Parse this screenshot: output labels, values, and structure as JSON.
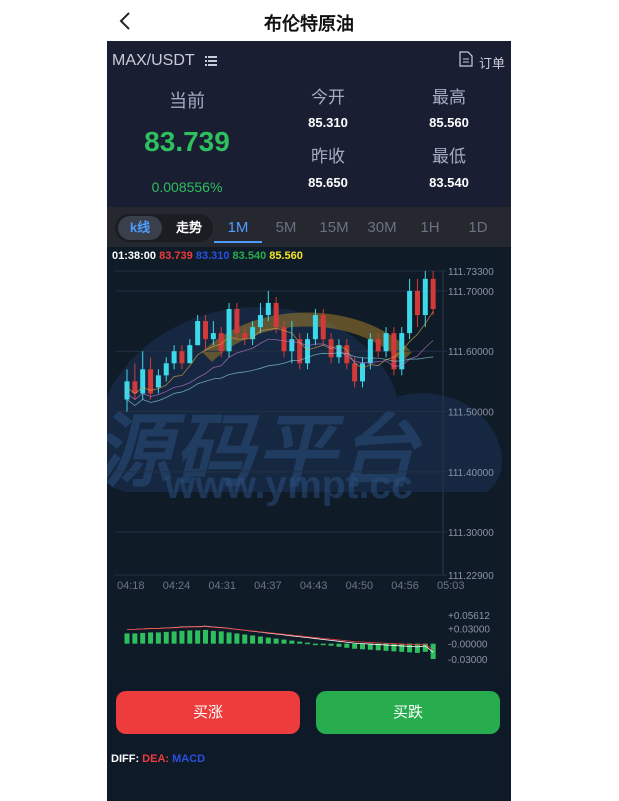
{
  "header_title": "布伦特原油",
  "pair": "MAX/USDT",
  "order_label": "订单",
  "current_label": "当前",
  "current_price": "83.739",
  "change_pct": "0.008556%",
  "stats": {
    "open_label": "今开",
    "open_value": "85.310",
    "high_label": "最高",
    "high_value": "85.560",
    "prev_close_label": "昨收",
    "prev_close_value": "85.650",
    "low_label": "最低",
    "low_value": "83.540"
  },
  "chart_mode": {
    "kline": "k线",
    "trend": "走势"
  },
  "intervals": [
    "1M",
    "5M",
    "15M",
    "30M",
    "1H",
    "1D"
  ],
  "active_interval": "1M",
  "ohlc_info": {
    "time": "01:38:00",
    "o": "83.739",
    "h": "83.310",
    "l": "83.540",
    "c": "85.560"
  },
  "watermark": {
    "cn": "源码平台",
    "url": "www.ympt.cc"
  },
  "buttons": {
    "buy_up": "买涨",
    "buy_down": "买跌"
  },
  "macd_legend": {
    "diff": "DIFF:",
    "dea": "DEA:",
    "macd": "MACD"
  },
  "colors": {
    "up": "#ee3b3b",
    "down": "#27ac4e",
    "accent": "#4f9cff",
    "candle_rise": "#3dd9e8",
    "candle_fall": "#d23a3a"
  },
  "chart_data": [
    {
      "type": "candlestick",
      "y_ticks": [
        "111.73300",
        "111.70000",
        "111.60000",
        "111.50000",
        "111.40000",
        "111.30000",
        "111.22900"
      ],
      "ylim": [
        111.229,
        111.733
      ],
      "x_ticks": [
        "04:18",
        "04:24",
        "04:31",
        "04:37",
        "04:43",
        "04:50",
        "04:56",
        "05:03"
      ],
      "candles": [
        {
          "o": 111.52,
          "c": 111.55,
          "h": 111.57,
          "l": 111.5
        },
        {
          "o": 111.55,
          "c": 111.53,
          "h": 111.58,
          "l": 111.52
        },
        {
          "o": 111.53,
          "c": 111.57,
          "h": 111.6,
          "l": 111.52
        },
        {
          "o": 111.57,
          "c": 111.53,
          "h": 111.59,
          "l": 111.52
        },
        {
          "o": 111.54,
          "c": 111.56,
          "h": 111.57,
          "l": 111.53
        },
        {
          "o": 111.56,
          "c": 111.58,
          "h": 111.59,
          "l": 111.55
        },
        {
          "o": 111.58,
          "c": 111.6,
          "h": 111.61,
          "l": 111.57
        },
        {
          "o": 111.6,
          "c": 111.58,
          "h": 111.61,
          "l": 111.57
        },
        {
          "o": 111.58,
          "c": 111.61,
          "h": 111.62,
          "l": 111.58
        },
        {
          "o": 111.61,
          "c": 111.65,
          "h": 111.66,
          "l": 111.61
        },
        {
          "o": 111.65,
          "c": 111.62,
          "h": 111.66,
          "l": 111.6
        },
        {
          "o": 111.62,
          "c": 111.63,
          "h": 111.65,
          "l": 111.61
        },
        {
          "o": 111.63,
          "c": 111.6,
          "h": 111.64,
          "l": 111.59
        },
        {
          "o": 111.6,
          "c": 111.67,
          "h": 111.68,
          "l": 111.59
        },
        {
          "o": 111.67,
          "c": 111.63,
          "h": 111.68,
          "l": 111.62
        },
        {
          "o": 111.63,
          "c": 111.62,
          "h": 111.64,
          "l": 111.61
        },
        {
          "o": 111.62,
          "c": 111.64,
          "h": 111.65,
          "l": 111.61
        },
        {
          "o": 111.64,
          "c": 111.66,
          "h": 111.68,
          "l": 111.63
        },
        {
          "o": 111.66,
          "c": 111.68,
          "h": 111.7,
          "l": 111.65
        },
        {
          "o": 111.68,
          "c": 111.64,
          "h": 111.69,
          "l": 111.63
        },
        {
          "o": 111.64,
          "c": 111.6,
          "h": 111.65,
          "l": 111.59
        },
        {
          "o": 111.6,
          "c": 111.62,
          "h": 111.65,
          "l": 111.58
        },
        {
          "o": 111.62,
          "c": 111.58,
          "h": 111.63,
          "l": 111.57
        },
        {
          "o": 111.58,
          "c": 111.62,
          "h": 111.63,
          "l": 111.57
        },
        {
          "o": 111.62,
          "c": 111.66,
          "h": 111.67,
          "l": 111.61
        },
        {
          "o": 111.66,
          "c": 111.62,
          "h": 111.67,
          "l": 111.61
        },
        {
          "o": 111.62,
          "c": 111.59,
          "h": 111.63,
          "l": 111.58
        },
        {
          "o": 111.59,
          "c": 111.61,
          "h": 111.62,
          "l": 111.58
        },
        {
          "o": 111.61,
          "c": 111.58,
          "h": 111.62,
          "l": 111.57
        },
        {
          "o": 111.58,
          "c": 111.55,
          "h": 111.59,
          "l": 111.54
        },
        {
          "o": 111.55,
          "c": 111.58,
          "h": 111.59,
          "l": 111.54
        },
        {
          "o": 111.58,
          "c": 111.62,
          "h": 111.63,
          "l": 111.57
        },
        {
          "o": 111.62,
          "c": 111.6,
          "h": 111.63,
          "l": 111.59
        },
        {
          "o": 111.6,
          "c": 111.63,
          "h": 111.64,
          "l": 111.59
        },
        {
          "o": 111.63,
          "c": 111.57,
          "h": 111.64,
          "l": 111.56
        },
        {
          "o": 111.57,
          "c": 111.63,
          "h": 111.64,
          "l": 111.56
        },
        {
          "o": 111.63,
          "c": 111.7,
          "h": 111.72,
          "l": 111.62
        },
        {
          "o": 111.7,
          "c": 111.66,
          "h": 111.72,
          "l": 111.64
        },
        {
          "o": 111.66,
          "c": 111.72,
          "h": 111.733,
          "l": 111.64
        },
        {
          "o": 111.72,
          "c": 111.67,
          "h": 111.733,
          "l": 111.66
        }
      ]
    },
    {
      "type": "bar",
      "name": "MACD",
      "y_ticks": [
        "+0.05612",
        "+0.03000",
        "-0.00000",
        "-0.03000"
      ],
      "ylim": [
        -0.03,
        0.05612
      ],
      "values": [
        0.02,
        0.02,
        0.021,
        0.022,
        0.022,
        0.023,
        0.024,
        0.025,
        0.026,
        0.026,
        0.027,
        0.025,
        0.024,
        0.022,
        0.02,
        0.018,
        0.016,
        0.014,
        0.012,
        0.01,
        0.008,
        0.006,
        0.004,
        0.002,
        0.0,
        -0.002,
        -0.004,
        -0.006,
        -0.008,
        -0.01,
        -0.011,
        -0.012,
        -0.013,
        -0.014,
        -0.015,
        -0.016,
        -0.017,
        -0.018,
        -0.016,
        -0.03
      ]
    }
  ]
}
